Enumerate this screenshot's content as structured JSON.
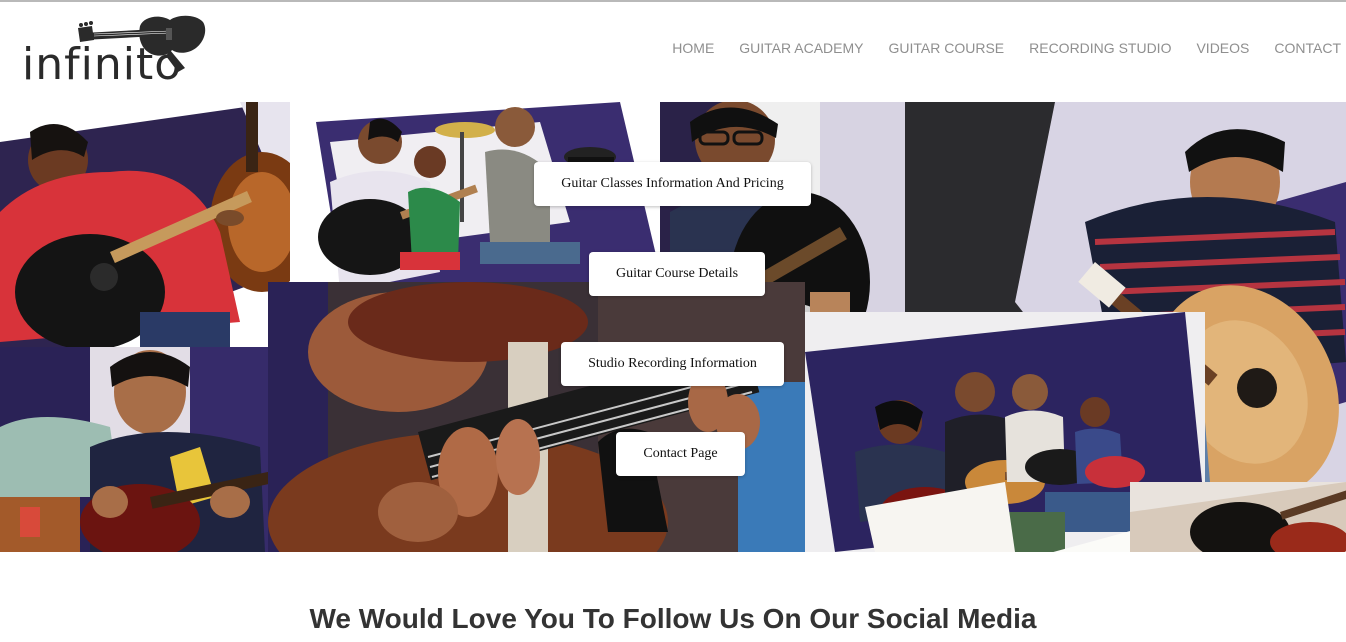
{
  "brand": {
    "logo_text": "infinito"
  },
  "nav": {
    "items": [
      "HOME",
      "GUITAR ACADEMY",
      "GUITAR COURSE",
      "RECORDING STUDIO",
      "VIDEOS",
      "CONTACT"
    ]
  },
  "hero": {
    "buttons": [
      "Guitar Classes Information And Pricing",
      "Guitar Course Details",
      "Studio Recording Information",
      "Contact Page"
    ]
  },
  "social": {
    "heading": "We Would Love You To Follow Us On Our Social Media"
  },
  "colors": {
    "nav_text": "#8f8f8f",
    "logo": "#2a2a2a",
    "heading": "#333333",
    "wall_purple": "#3a2a6e",
    "shirt_red": "#d8333a",
    "guitar_wood": "#b06a2a"
  }
}
